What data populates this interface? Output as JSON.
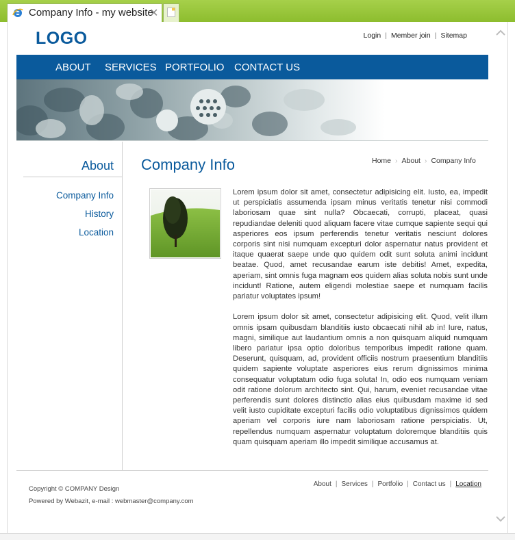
{
  "browser": {
    "tab_title": "Company Info - my website",
    "close_glyph": "✕"
  },
  "site": {
    "logo": "LOGO",
    "brand_color": "#0a5a9c"
  },
  "util_links": [
    "Login",
    "Member join",
    "Sitemap"
  ],
  "nav": [
    "ABOUT",
    "SERVICES",
    "PORTFOLIO",
    "CONTACT US"
  ],
  "sidebar": {
    "title": "About",
    "items": [
      "Company Info",
      "History",
      "Location"
    ]
  },
  "main": {
    "title": "Company Info",
    "breadcrumb": [
      "Home",
      "About",
      "Company Info"
    ],
    "paragraphs": [
      "Lorem ipsum dolor sit amet, consectetur adipisicing elit. Iusto, ea, impedit ut perspiciatis assumenda ipsam minus veritatis tenetur nisi commodi laboriosam quae sint nulla? Obcaecati, corrupti, placeat, quasi repudiandae deleniti quod aliquam facere vitae cumque sapiente sequi qui asperiores eos ipsum perferendis tenetur veritatis nesciunt dolores corporis sint nisi numquam excepturi dolor aspernatur natus provident et itaque quaerat saepe unde quo quidem odit sunt soluta animi incidunt beatae. Quod, amet recusandae earum iste debitis! Amet, expedita, aperiam, sint omnis fuga magnam eos quidem alias soluta nobis sunt unde incidunt! Ratione, autem eligendi molestiae saepe et numquam facilis pariatur voluptates ipsum!",
      "Lorem ipsum dolor sit amet, consectetur adipisicing elit. Quod, velit illum omnis ipsam quibusdam blanditiis iusto obcaecati nihil ab in! Iure, natus, magni, similique aut laudantium omnis a non quisquam aliquid numquam libero pariatur ipsa optio doloribus temporibus impedit ratione quam. Deserunt, quisquam, ad, provident officiis nostrum praesentium blanditiis quidem sapiente voluptate asperiores eius rerum dignissimos minima consequatur voluptatum odio fuga soluta! In, odio eos numquam veniam odit ratione dolorum architecto sint. Qui, harum, eveniet recusandae vitae perferendis sunt dolores distinctio alias eius quibusdam maxime id sed velit iusto cupiditate excepturi facilis odio voluptatibus dignissimos quidem aperiam vel corporis iure nam laboriosam ratione perspiciatis. Ut, repellendus numquam aspernatur voluptatum doloremque blanditiis quis quam quisquam aperiam illo impedit similique accusamus at."
    ]
  },
  "footer": {
    "copyright": "Copyright © COMPANY Design",
    "powered": "Powered by Webazit, e-mail : webmaster@company.com",
    "links": [
      "About",
      "Services",
      "Portfolio",
      "Contact us",
      "Location"
    ]
  }
}
